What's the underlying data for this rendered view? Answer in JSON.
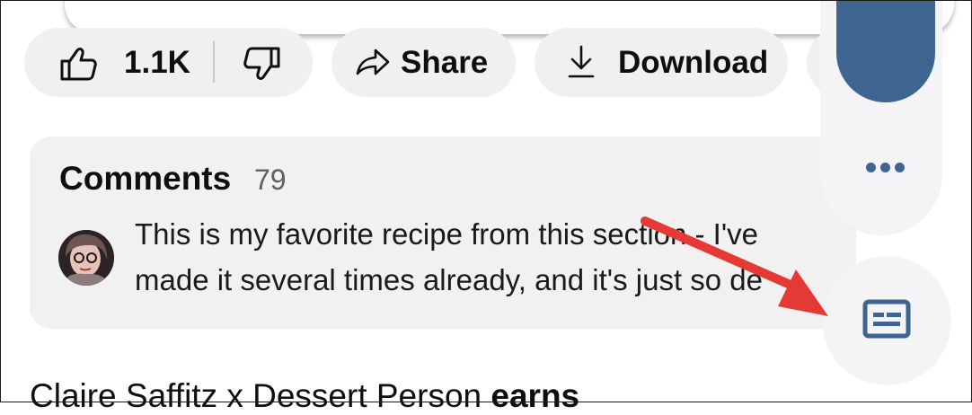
{
  "actions": {
    "like_count": "1.1K",
    "share_label": "Share",
    "download_label": "Download"
  },
  "comments": {
    "title": "Comments",
    "count": "79",
    "line1": "This is my favorite recipe from this section - I've",
    "line2": "made it several times already, and it's just so de"
  },
  "next_video": {
    "title_prefix": "Claire Saffitz x Dessert Person ",
    "title_bold": "earns"
  },
  "side_panel": {
    "more_icon": "more-horizontal-icon",
    "captions_icon": "closed-captions-icon"
  },
  "colors": {
    "accent_blue": "#3d6590",
    "annotation_arrow": "#e53935",
    "pill_bg": "#f0f0f0"
  }
}
